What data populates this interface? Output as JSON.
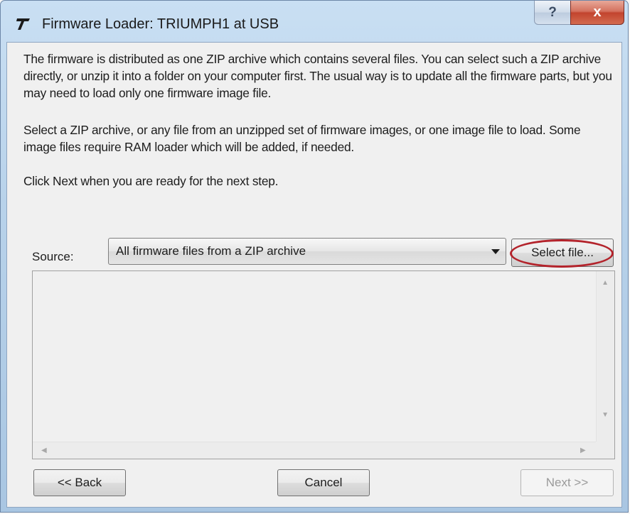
{
  "window": {
    "title": "Firmware Loader: TRIUMPH1 at USB",
    "help_label": "?",
    "close_label": "x"
  },
  "content": {
    "paragraph1": "The firmware is distributed as one ZIP archive which contains several files. You can select such a ZIP archive directly, or unzip it into a folder on your computer first. The usual way is to update all the firmware parts, but you may need to load only one firmware image file.",
    "paragraph2": "Select a ZIP archive, or any file from an unzipped set of firmware images, or one image file to load. Some image files require RAM loader which will be added, if needed.",
    "paragraph3": "Click Next when you are ready for the next step."
  },
  "source": {
    "label": "Source:",
    "selected_value": "All firmware files from a ZIP archive",
    "select_file_label": "Select file..."
  },
  "footer": {
    "back_label": "<< Back",
    "cancel_label": "Cancel",
    "next_label": "Next >>",
    "next_enabled": false
  },
  "colors": {
    "highlight_ring": "#b3232b",
    "title_bar": "#b8d2ea",
    "close_button": "#c2442e"
  }
}
